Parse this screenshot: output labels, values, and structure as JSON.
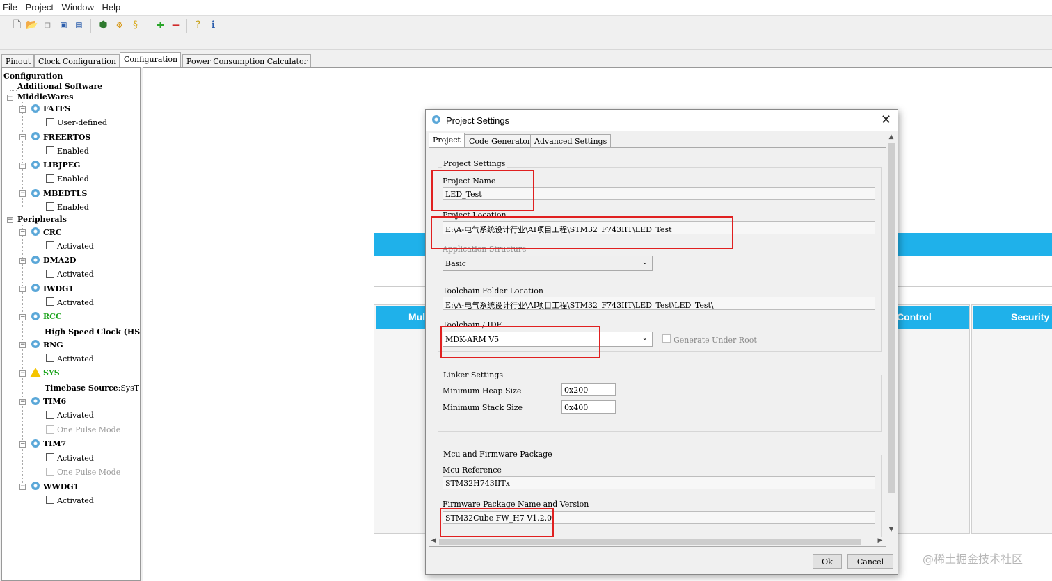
{
  "menu": [
    "File",
    "Project",
    "Window",
    "Help"
  ],
  "toolbar": {
    "icons": [
      "new-project-icon",
      "open-project-icon",
      "copy-icon",
      "save-icon",
      "save-as-icon",
      "generate-icon",
      "install-icon",
      "report-icon",
      "add-icon",
      "remove-icon",
      "help-icon",
      "about-icon"
    ]
  },
  "main_tabs": [
    "Pinout",
    "Clock Configuration",
    "Configuration",
    "Power Consumption Calculator"
  ],
  "active_main_tab": "Configuration",
  "tree": {
    "root": "Configuration",
    "additional": "Additional Software",
    "middlewares": "MiddleWares",
    "fatfs": "FATFS",
    "fatfs_opt": "User-defined",
    "freertos": "FREERTOS",
    "freertos_opt": "Enabled",
    "libjpeg": "LIBJPEG",
    "libjpeg_opt": "Enabled",
    "mbedtls": "MBEDTLS",
    "mbedtls_opt": "Enabled",
    "peripherals": "Peripherals",
    "crc": "CRC",
    "crc_opt": "Activated",
    "dma2d": "DMA2D",
    "dma2d_opt": "Activated",
    "iwdg1": "IWDG1",
    "iwdg1_opt": "Activated",
    "rcc": "RCC",
    "rcc_opt": "High Speed Clock (HS",
    "rng": "RNG",
    "rng_opt": "Activated",
    "sys": "SYS",
    "sys_opt_label": "Timebase Source",
    "sys_opt_value": ":SysT",
    "tim6": "TIM6",
    "tim6_opt1": "Activated",
    "tim6_opt2": "One Pulse Mode",
    "tim7": "TIM7",
    "tim7_opt1": "Activated",
    "tim7_opt2": "One Pulse Mode",
    "wwdg1": "WWDG1",
    "wwdg1_opt": "Activated",
    "colors": {
      "green_nodes": "#1aa31a",
      "warning": "#f5c400"
    }
  },
  "canvas": {
    "panels": [
      "Mul",
      "Control",
      "Security"
    ],
    "accent": "#1fb1ea"
  },
  "dialog": {
    "title": "Project Settings",
    "tabs": [
      "Project",
      "Code Generator",
      "Advanced Settings"
    ],
    "active_tab": "Project",
    "project_settings_group": "Project Settings",
    "project_name_label": "Project Name",
    "project_name": "LED_Test",
    "project_location_label": "Project Location",
    "project_location": "E:\\A-电气系统设计行业\\AI项目工程\\STM32_F743IIT\\LED_Test",
    "app_structure_label": "Application Structure",
    "app_structure": "Basic",
    "toolchain_folder_label": "Toolchain Folder Location",
    "toolchain_folder": "E:\\A-电气系统设计行业\\AI项目工程\\STM32_F743IIT\\LED_Test\\LED_Test\\",
    "toolchain_ide_label": "Toolchain / IDE",
    "toolchain_ide": "MDK-ARM V5",
    "generate_under_root": "Generate Under Root",
    "linker_group": "Linker Settings",
    "heap_label": "Minimum Heap Size",
    "heap": "0x200",
    "stack_label": "Minimum Stack Size",
    "stack": "0x400",
    "mcu_group": "Mcu and Firmware Package",
    "mcu_ref_label": "Mcu Reference",
    "mcu_ref": "STM32H743IITx",
    "fw_label": "Firmware Package Name and Version",
    "fw": "STM32Cube FW_H7 V1.2.0",
    "ok": "Ok",
    "cancel": "Cancel",
    "highlight_color": "#e02020"
  },
  "watermark": "@稀土掘金技术社区"
}
